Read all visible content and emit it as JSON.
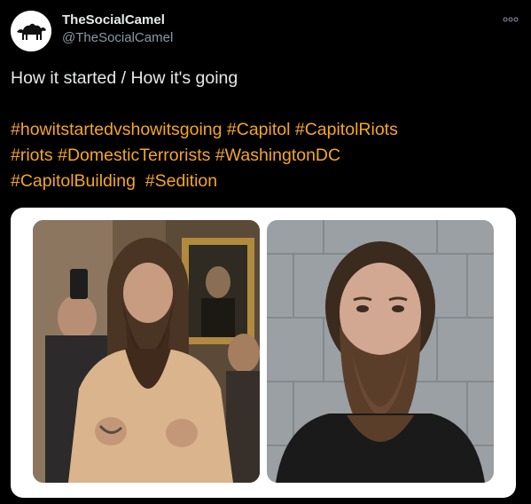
{
  "author": {
    "display_name": "TheSocialCamel",
    "handle": "@TheSocialCamel",
    "avatar_icon": "camel-logo-icon"
  },
  "tweet": {
    "text": "How it started / How it's going",
    "hashtags": [
      "#howitstartedvshowitsgoing",
      "#Capitol",
      "#CapitolRiots",
      "#riots",
      "#DomesticTerrorists",
      "#WashingtonDC",
      "#CapitolBuilding",
      "#Sedition"
    ]
  },
  "colors": {
    "background": "#000000",
    "text": "#e7e9ea",
    "secondary_text": "#8b98a5",
    "hashtag": "#f5a623",
    "media_frame": "#ffffff"
  },
  "icons": {
    "more": "more-options-icon"
  }
}
